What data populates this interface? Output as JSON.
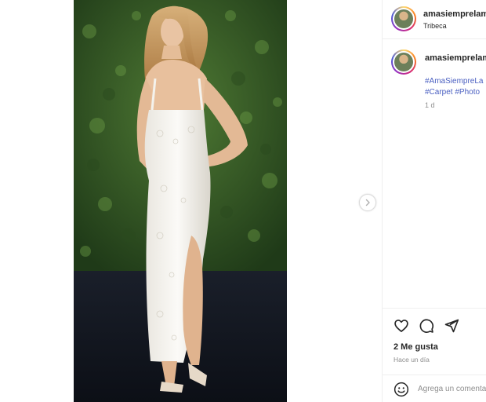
{
  "post": {
    "username": "amasiemprelam",
    "location": "Tribeca",
    "photo_description_icon": "photo",
    "next_icon": "chevron-right-icon"
  },
  "caption": {
    "username": "amasiemprelam",
    "hashtag_line1": "#AmaSiempreLa",
    "hashtag_line2": "#Carpet #Photo",
    "time": "1 d"
  },
  "actions": {
    "like_icon": "heart-icon",
    "comment_icon": "comment-icon",
    "share_icon": "send-icon",
    "likes": "2 Me gusta",
    "ago": "Hace un día"
  },
  "comment": {
    "emoji_icon": "smile-icon",
    "placeholder": "Agrega un comentario..."
  },
  "colors": {
    "hashtag": "#4a5fc1",
    "muted": "#8e8e8e",
    "text": "#262626"
  }
}
